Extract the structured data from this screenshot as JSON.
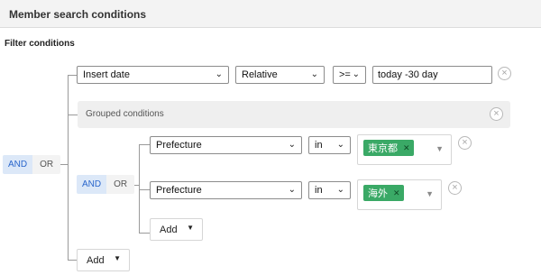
{
  "header": {
    "title": "Member search conditions"
  },
  "section": {
    "title": "Filter conditions"
  },
  "root": {
    "operator": {
      "and_label": "AND",
      "or_label": "OR"
    },
    "condition": {
      "field": "Insert date",
      "mode": "Relative",
      "comparator": ">=",
      "value": "today -30 day",
      "remove_label": "×"
    },
    "group": {
      "label": "Grouped conditions",
      "remove_label": "×",
      "operator": {
        "and_label": "AND",
        "or_label": "OR"
      },
      "conditions": [
        {
          "field": "Prefecture",
          "operator": "in",
          "tag": "東京都",
          "tag_remove": "✕",
          "remove_label": "×"
        },
        {
          "field": "Prefecture",
          "operator": "in",
          "tag": "海外",
          "tag_remove": "✕",
          "remove_label": "×"
        }
      ],
      "add_label": "Add"
    },
    "add_label": "Add"
  },
  "icons": {
    "select_chevron": "chevron-down-icon",
    "remove": "close-circle-icon",
    "add_caret": "caret-down-icon"
  },
  "colors": {
    "tag_bg": "#3aa966",
    "and_active_bg": "#dce8f8",
    "and_active_text": "#2a66cc",
    "group_bg": "#efefef"
  }
}
